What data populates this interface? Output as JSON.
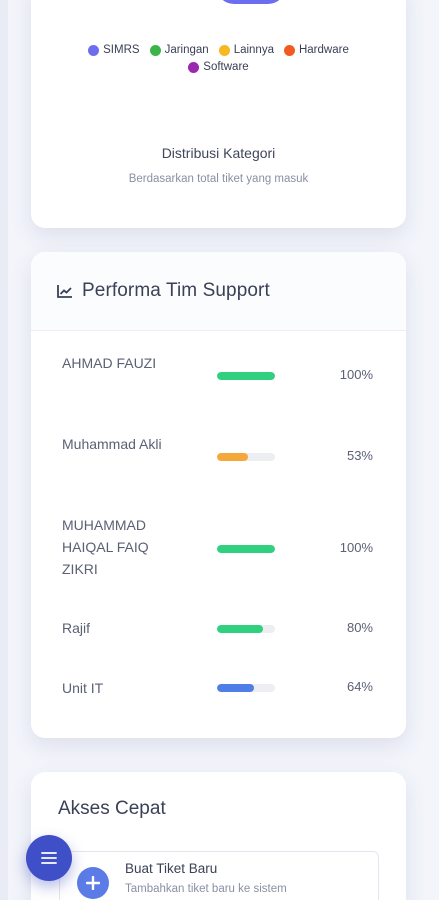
{
  "category_card": {
    "legend": [
      {
        "label": "SIMRS",
        "color": "#6c6ef0"
      },
      {
        "label": "Jaringan",
        "color": "#3bb54a"
      },
      {
        "label": "Lainnya",
        "color": "#f5b921"
      },
      {
        "label": "Hardware",
        "color": "#f25a22"
      },
      {
        "label": "Software",
        "color": "#9c27b0"
      }
    ],
    "title": "Distribusi Kategori",
    "subtitle": "Berdasarkan total tiket yang masuk"
  },
  "performance_card": {
    "title": "Performa Tim Support",
    "icon": "line-chart-icon",
    "members": [
      {
        "name": "AHMAD FAUZI",
        "percent": 100,
        "percent_label": "100%",
        "color": "#2fd17f"
      },
      {
        "name": "Muhammad Akli",
        "percent": 53,
        "percent_label": "53%",
        "color": "#f5a83a"
      },
      {
        "name": "MUHAMMAD HAIQAL FAIQ ZIKRI",
        "percent": 100,
        "percent_label": "100%",
        "color": "#2fd17f"
      },
      {
        "name": "Rajif",
        "percent": 80,
        "percent_label": "80%",
        "color": "#2fd17f"
      },
      {
        "name": "Unit IT",
        "percent": 64,
        "percent_label": "64%",
        "color": "#4f7fe6"
      }
    ]
  },
  "quick_access": {
    "title": "Akses Cepat",
    "items": [
      {
        "label": "Buat Tiket Baru",
        "description": "Tambahkan tiket baru ke sistem",
        "icon": "plus-icon"
      }
    ]
  },
  "fab": {
    "icon": "menu-icon"
  }
}
